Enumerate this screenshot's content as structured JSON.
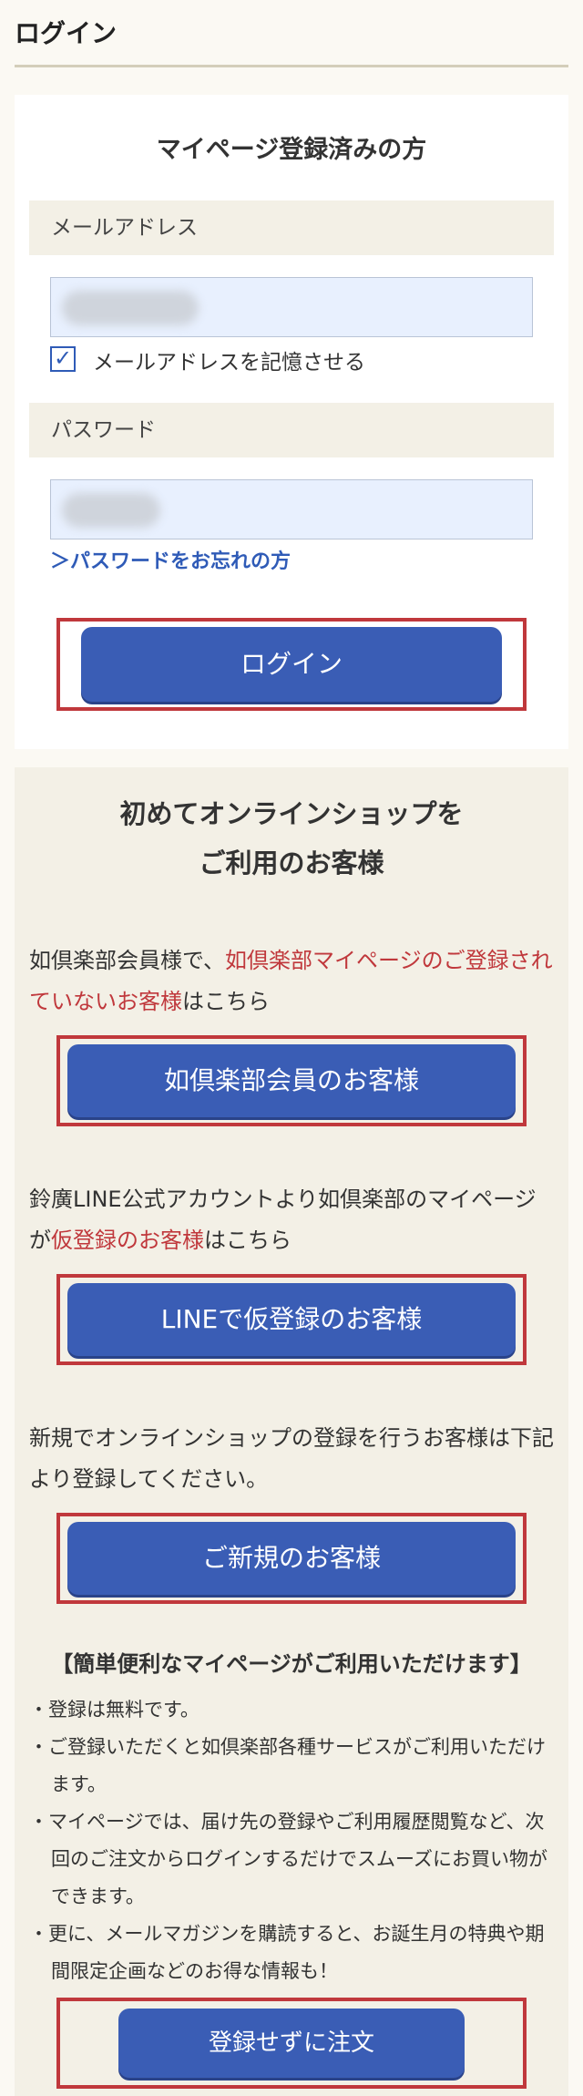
{
  "page": {
    "title": "ログイン"
  },
  "login": {
    "heading": "マイページ登録済みの方",
    "email_label": "メールアドレス",
    "remember_label": "メールアドレスを記憶させる",
    "password_label": "パスワード",
    "forgot_link": "＞パスワードをお忘れの方",
    "login_button": "ログイン"
  },
  "new_customer": {
    "heading_line1": "初めてオンラインショップを",
    "heading_line2": "ご利用のお客様",
    "member": {
      "text_before": "如倶楽部会員様で、",
      "text_red": "如倶楽部マイページのご登録されていないお客様",
      "text_after": "はこちら",
      "button": "如倶楽部会員のお客様"
    },
    "line": {
      "text_before": "鈴廣LINE公式アカウントより如倶楽部のマイページが",
      "text_red": "仮登録のお客様",
      "text_after": "はこちら",
      "button": "LINEで仮登録のお客様"
    },
    "new": {
      "text": "新規でオンラインショップの登録を行うお客様は下記より登録してください。",
      "button": "ご新規のお客様"
    },
    "benefits": {
      "heading": "【簡単便利なマイページがご利用いただけます】",
      "items": [
        "・登録は無料です。",
        "・ご登録いただくと如倶楽部各種サービスがご利用いただけます。",
        "・マイページでは、届け先の登録やご利用履歴閲覧など、次回のご注文からログインするだけでスムーズにお買い物ができます。",
        "・更に、メールマガジンを購読すると、お誕生月の特典や期間限定企画などのお得な情報も！"
      ]
    },
    "guest_button": "登録せずに注文"
  },
  "colors": {
    "accent_blue": "#3a5db5",
    "frame_red": "#c0383c",
    "section_bg": "#f3f0e6"
  }
}
